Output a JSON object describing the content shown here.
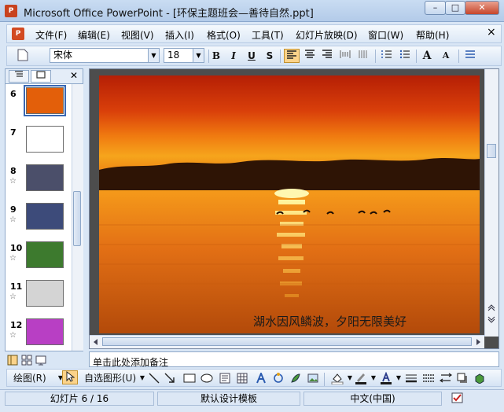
{
  "window": {
    "title": "Microsoft Office PowerPoint - [环保主题班会—善待自然.ppt]",
    "min_label": "–",
    "max_label": "□",
    "close_label": "✕"
  },
  "menu": {
    "items": [
      "文件(F)",
      "编辑(E)",
      "视图(V)",
      "插入(I)",
      "格式(O)",
      "工具(T)",
      "幻灯片放映(D)",
      "窗口(W)",
      "帮助(H)"
    ],
    "close_glyph": "×"
  },
  "toolbar": {
    "font_name": "宋体",
    "font_size": "18",
    "bold": "B",
    "italic": "I",
    "underline": "U",
    "shadow": "S",
    "increase_font": "A",
    "decrease_font": "A"
  },
  "slides_pane": {
    "close_glyph": "✕",
    "star_glyph": "☆",
    "thumbnails": [
      {
        "number": "6",
        "selected": true,
        "star": false,
        "color": "#e35f0a"
      },
      {
        "number": "7",
        "selected": false,
        "star": false,
        "color": "#ffffff"
      },
      {
        "number": "8",
        "selected": false,
        "star": true,
        "color": "#4b4f6a"
      },
      {
        "number": "9",
        "selected": false,
        "star": true,
        "color": "#3d4b7a"
      },
      {
        "number": "10",
        "selected": false,
        "star": true,
        "color": "#3d7a2e"
      },
      {
        "number": "11",
        "selected": false,
        "star": true,
        "color": "#d4d4d4"
      },
      {
        "number": "12",
        "selected": false,
        "star": true,
        "color": "#b83fc4"
      }
    ]
  },
  "slide": {
    "caption": "湖水因风鳞波，夕阳无限美好"
  },
  "notes": {
    "placeholder": "单击此处添加备注"
  },
  "drawing_toolbar": {
    "draw_label": "绘图(R)",
    "autoshapes_label": "自选图形(U)"
  },
  "status": {
    "slide_position": "幻灯片 6 / 16",
    "template": "默认设计模板",
    "language": "中文(中国)"
  },
  "colors": {
    "accent": "#fbd38a",
    "title_bar": "#b3cbe9"
  }
}
